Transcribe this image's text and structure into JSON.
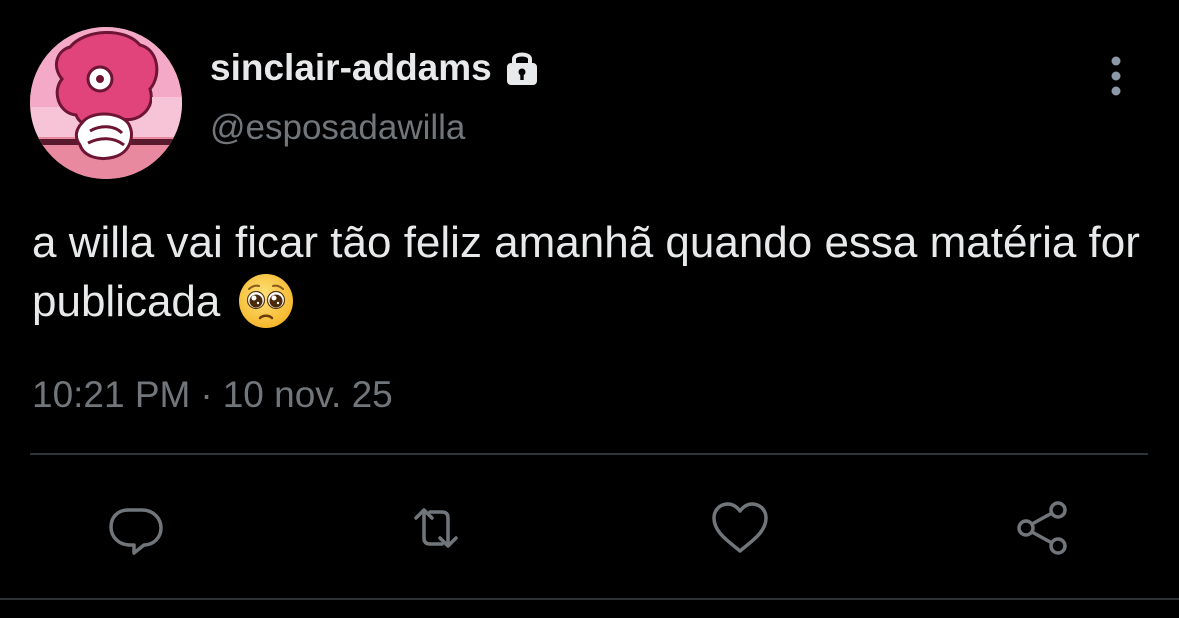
{
  "tweet": {
    "display_name": "sinclair-addams",
    "handle": "@esposadawilla",
    "text": "a willa vai ficar tão feliz amanhã quando essa matéria for publicada",
    "time": "10:21 PM",
    "separator": "·",
    "date": "10 nov. 25",
    "protected_icon": "lock-icon",
    "emoji": "pleading-face-emoji"
  },
  "actions": {
    "reply_icon": "reply-icon",
    "retweet_icon": "retweet-icon",
    "like_icon": "heart-icon",
    "share_icon": "share-icon"
  },
  "colors": {
    "background": "#000000",
    "primary_text": "#e7e9ea",
    "secondary_text": "#71767b",
    "divider": "#2f3336",
    "icon": "#71767b",
    "avatar_pink": "#e0447a",
    "avatar_light_pink": "#f4a9c6"
  }
}
